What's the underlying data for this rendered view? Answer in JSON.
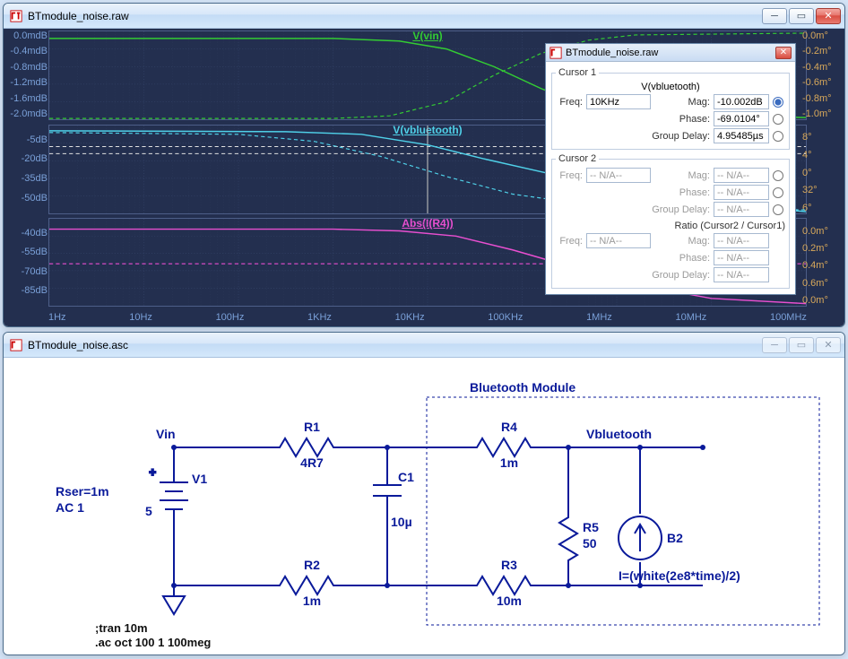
{
  "plot_window": {
    "title": "BTmodule_noise.raw",
    "xlabels": [
      "1Hz",
      "10Hz",
      "100Hz",
      "1KHz",
      "10KHz",
      "100KHz",
      "1MHz",
      "10MHz",
      "100MHz"
    ]
  },
  "panes": [
    {
      "label": "V(vin)",
      "label_color": "#33cc33",
      "yleft": [
        "0.0mdB",
        "-0.4mdB",
        "-0.8mdB",
        "-1.2mdB",
        "-1.6mdB",
        "-2.0mdB"
      ],
      "yright": [
        "0.0m°",
        "-0.2m°",
        "-0.4m°",
        "-0.6m°",
        "-0.8m°",
        "-1.0m°"
      ],
      "yright_color": "#d8a85a"
    },
    {
      "label": "V(vbluetooth)",
      "label_color": "#4fd0e8",
      "yleft": [
        "",
        "-5dB",
        "-20dB",
        "-35dB",
        "-50dB",
        ""
      ],
      "yright": [
        "",
        "8°",
        "4°",
        "0°",
        "32°",
        "6°"
      ],
      "yright_color": "#d8a85a"
    },
    {
      "label": "Abs(I(R4))",
      "label_color": "#e84fd0",
      "yleft": [
        "",
        "-40dB",
        "-55dB",
        "-70dB",
        "-85dB",
        ""
      ],
      "yright": [
        "",
        "0.0m°",
        "0.2m°",
        "0.4m°",
        "0.6m°",
        "0.0m°"
      ],
      "yright_color": "#d8a85a"
    }
  ],
  "cursor_dialog": {
    "title": "BTmodule_noise.raw",
    "cursor1": {
      "legend": "Cursor 1",
      "group": "V(vbluetooth)",
      "freq_label": "Freq:",
      "freq": "10KHz",
      "mag_label": "Mag:",
      "mag": "-10.002dB",
      "phase_label": "Phase:",
      "phase": "-69.0104°",
      "gd_label": "Group Delay:",
      "gd": "4.95485µs"
    },
    "cursor2": {
      "legend": "Cursor 2",
      "freq_label": "Freq:",
      "freq": "-- N/A--",
      "mag_label": "Mag:",
      "mag": "-- N/A--",
      "phase_label": "Phase:",
      "phase": "-- N/A--",
      "gd_label": "Group Delay:",
      "gd": "-- N/A--"
    },
    "ratio": {
      "label": "Ratio (Cursor2 / Cursor1)",
      "freq_label": "Freq:",
      "freq": "-- N/A--",
      "mag_label": "Mag:",
      "mag": "-- N/A--",
      "phase_label": "Phase:",
      "phase": "-- N/A--",
      "gd_label": "Group Delay:",
      "gd": "-- N/A--"
    }
  },
  "schematic_window": {
    "title": "BTmodule_noise.asc"
  },
  "schematic": {
    "module_title": "Bluetooth Module",
    "nodes": {
      "vin": "Vin",
      "vbt": "Vbluetooth"
    },
    "comps": {
      "V1": {
        "name": "V1",
        "value": "5",
        "param": "Rser=1m",
        "param2": "AC 1"
      },
      "R1": {
        "name": "R1",
        "value": "4R7"
      },
      "R2": {
        "name": "R2",
        "value": "1m"
      },
      "R3": {
        "name": "R3",
        "value": "10m"
      },
      "R4": {
        "name": "R4",
        "value": "1m"
      },
      "R5": {
        "name": "R5",
        "value": "50"
      },
      "C1": {
        "name": "C1",
        "value": "10µ"
      },
      "B2": {
        "name": "B2",
        "value": "I=(white(2e8*time)/2)"
      }
    },
    "directives": {
      "tran": ";tran 10m",
      "ac": ".ac oct 100 1 100meg"
    }
  },
  "chart_data": {
    "type": "line",
    "x_axis": {
      "scale": "log",
      "unit": "Hz",
      "range": [
        1,
        100000000.0
      ],
      "ticks": [
        1,
        10,
        100,
        1000.0,
        10000.0,
        100000.0,
        1000000.0,
        10000000.0,
        100000000.0
      ],
      "tick_labels": [
        "1Hz",
        "10Hz",
        "100Hz",
        "1KHz",
        "10KHz",
        "100KHz",
        "1MHz",
        "10MHz",
        "100MHz"
      ]
    },
    "panes": [
      {
        "title": "V(vin)",
        "y_left": {
          "unit": "dB",
          "range": [
            -0.002,
            0.0
          ]
        },
        "y_right": {
          "unit": "deg",
          "range": [
            -0.001,
            0.0
          ]
        },
        "series": [
          {
            "name": "mag",
            "axis": "left",
            "color": "#33cc33",
            "x": [
              1,
              10,
              100,
              1000.0,
              3000.0,
              10000.0,
              30000.0,
              100000.0,
              1000000.0,
              10000000.0,
              100000000.0
            ],
            "y": [
              -0.00016,
              -0.00016,
              -0.00016,
              -0.00018,
              -0.00028,
              -0.0007,
              -0.0012,
              -0.0017,
              -0.002,
              -0.002,
              -0.002
            ]
          },
          {
            "name": "phase",
            "axis": "right",
            "color": "#33cc33",
            "dash": true,
            "x": [
              1,
              100,
              1000.0,
              5000.0,
              20000.0,
              100000.0,
              1000000.0,
              100000000.0
            ],
            "y": [
              -0.001,
              -0.001,
              -0.001,
              -0.0009,
              -0.0005,
              -0.00015,
              0.0,
              0.0
            ]
          }
        ]
      },
      {
        "title": "V(vbluetooth)",
        "y_left": {
          "unit": "dB",
          "range": [
            -50,
            0
          ]
        },
        "y_right": {
          "unit": "deg",
          "range": [
            -96,
            8
          ]
        },
        "series": [
          {
            "name": "mag",
            "axis": "left",
            "color": "#4fd0e8",
            "x": [
              1,
              100,
              1000.0,
              3000.0,
              10000.0,
              30000.0,
              100000.0,
              300000.0,
              1000000.0,
              10000000.0,
              100000000.0
            ],
            "y": [
              0,
              0,
              -0.3,
              -1.5,
              -10,
              -18,
              -28,
              -37,
              -47,
              -50,
              -50
            ]
          },
          {
            "name": "phase",
            "axis": "right",
            "color": "#4fd0e8",
            "dash": true,
            "x": [
              1,
              100,
              1000.0,
              3000.0,
              10000.0,
              30000.0,
              100000.0,
              1000000.0,
              100000000.0
            ],
            "y": [
              0,
              -2,
              -15,
              -40,
              -69,
              -82,
              -88,
              -90,
              -90
            ]
          }
        ]
      },
      {
        "title": "Abs(I(R4))",
        "y_left": {
          "unit": "dB",
          "range": [
            -85,
            -25
          ]
        },
        "y_right": {
          "unit": "deg",
          "range": [
            -0.001,
            0.0
          ]
        },
        "series": [
          {
            "name": "mag",
            "axis": "left",
            "color": "#e84fd0",
            "x": [
              1,
              100,
              1000.0,
              3000.0,
              10000.0,
              30000.0,
              100000.0,
              300000.0,
              1000000.0,
              10000000.0,
              100000000.0
            ],
            "y": [
              -34,
              -34,
              -34.5,
              -36,
              -38,
              -45,
              -55,
              -65,
              -76,
              -85,
              -85
            ]
          },
          {
            "name": "phase",
            "axis": "right",
            "color": "#e84fd0",
            "dash": true,
            "x": [
              1,
              100000000.0
            ],
            "y": [
              -0.00055,
              -0.00055
            ]
          }
        ]
      }
    ]
  }
}
